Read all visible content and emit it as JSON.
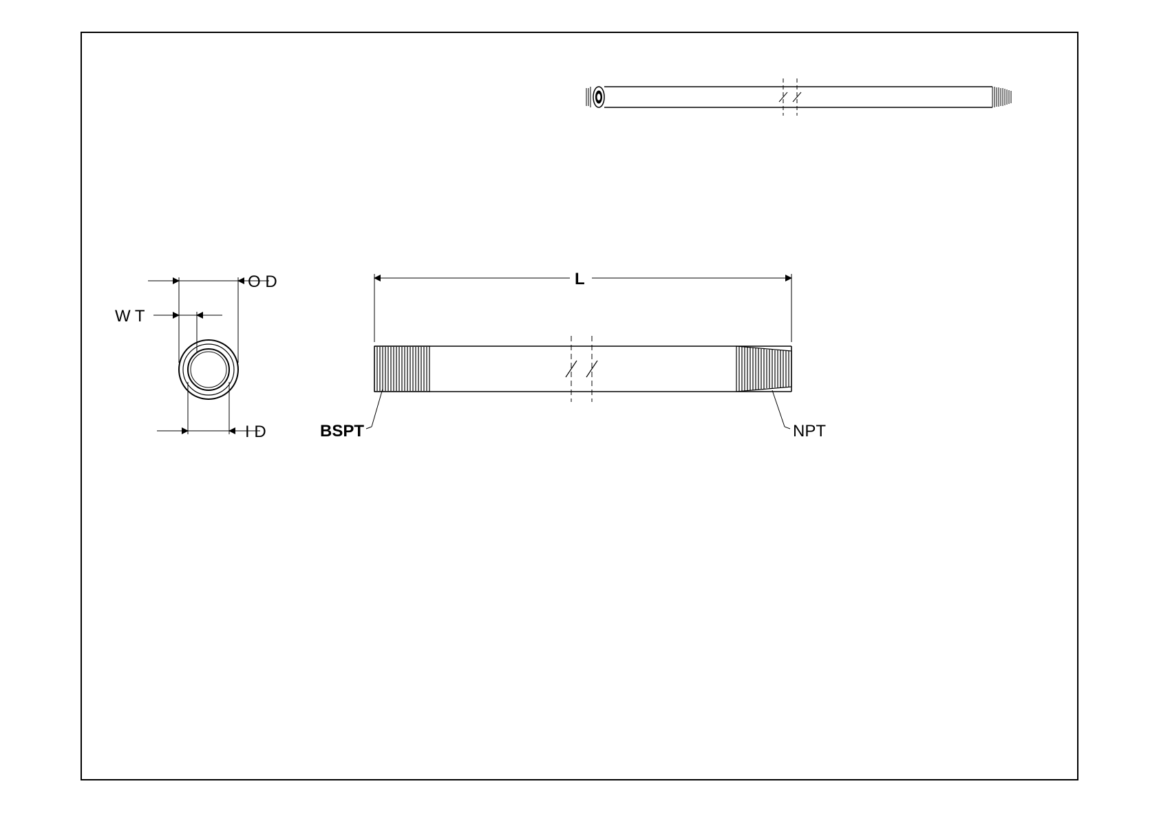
{
  "labels": {
    "od": "O D",
    "wt": "W T",
    "id": "I D",
    "bspt": "BSPT",
    "npt": "NPT",
    "l": "L"
  }
}
